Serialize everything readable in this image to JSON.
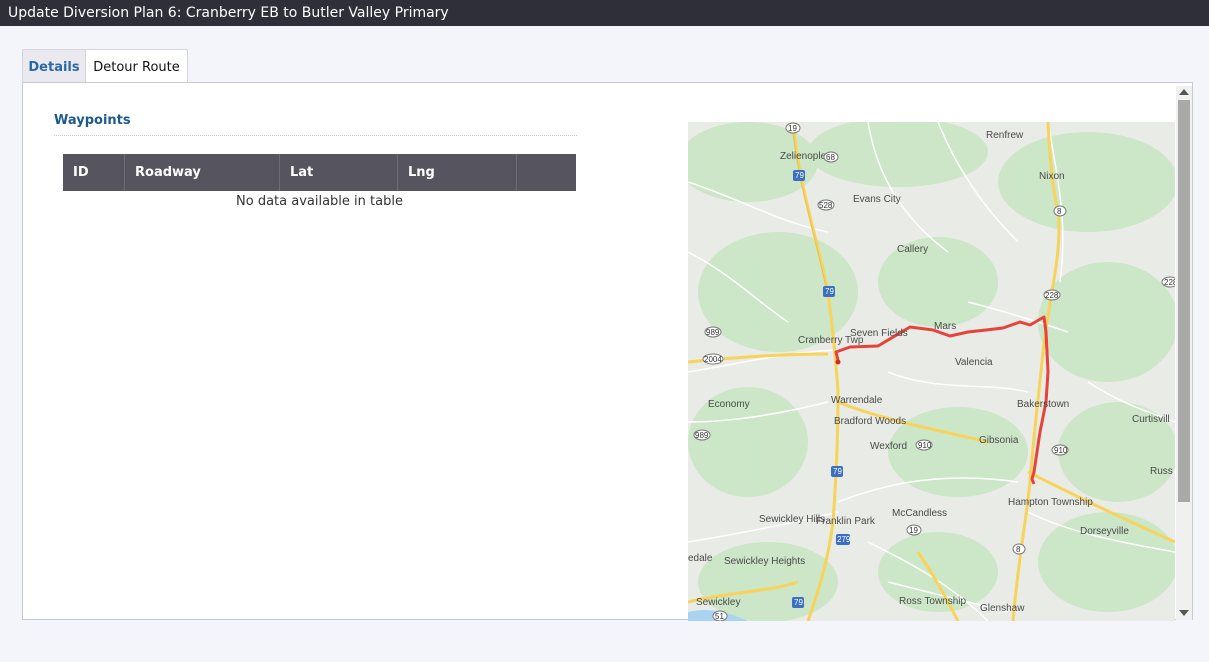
{
  "window": {
    "title": "Update Diversion Plan 6: Cranberry EB to Butler Valley Primary"
  },
  "tabs": [
    {
      "label": "Details",
      "active": false
    },
    {
      "label": "Detour Route",
      "active": true
    }
  ],
  "waypoints": {
    "title": "Waypoints",
    "columns": [
      "ID",
      "Roadway",
      "Lat",
      "Lng",
      ""
    ],
    "rows": [],
    "empty_message": "No data available in table"
  },
  "map": {
    "route_color": "#e8433a",
    "towns": [
      "Renfrew",
      "Zelienople",
      "Nixon",
      "Evans City",
      "Callery",
      "Seven Fields",
      "Mars",
      "Cranberry Twp",
      "Valencia",
      "Economy",
      "Warrendale",
      "Bakerstown",
      "Curtisvill",
      "Bradford Woods",
      "Gibsonia",
      "Wexford",
      "Russ",
      "Hampton Township",
      "Sewickley Hills",
      "Franklin Park",
      "McCandless",
      "Dorseyville",
      "Sewickley Heights",
      "Ross Township",
      "Sewickley",
      "Glenshaw",
      "edale"
    ],
    "shields": [
      "19",
      "68",
      "79",
      "528",
      "8",
      "228",
      "228",
      "79",
      "989",
      "2004",
      "910",
      "989",
      "910",
      "79",
      "279",
      "19",
      "8",
      "79",
      "51"
    ]
  }
}
